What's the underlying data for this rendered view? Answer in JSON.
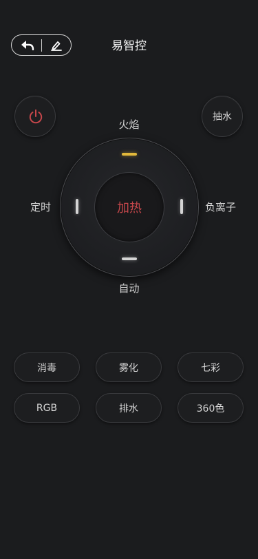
{
  "header": {
    "title": "易智控",
    "back_icon": "back-arrow-icon",
    "edit_icon": "edit-pencil-icon"
  },
  "top_buttons": {
    "power_icon": "power-icon",
    "power_color": "#c6474b",
    "pump_label": "抽水"
  },
  "dial": {
    "center_label": "加热",
    "center_color": "#c6474b",
    "up_label": "火焰",
    "down_label": "自动",
    "left_label": "定时",
    "right_label": "负离子",
    "up_indicator_color": "#e2b93b",
    "down_indicator_color": "#d4d4d4"
  },
  "function_buttons": [
    {
      "label": "消毒"
    },
    {
      "label": "雾化"
    },
    {
      "label": "七彩"
    },
    {
      "label": "RGB"
    },
    {
      "label": "排水"
    },
    {
      "label": "360色"
    }
  ]
}
